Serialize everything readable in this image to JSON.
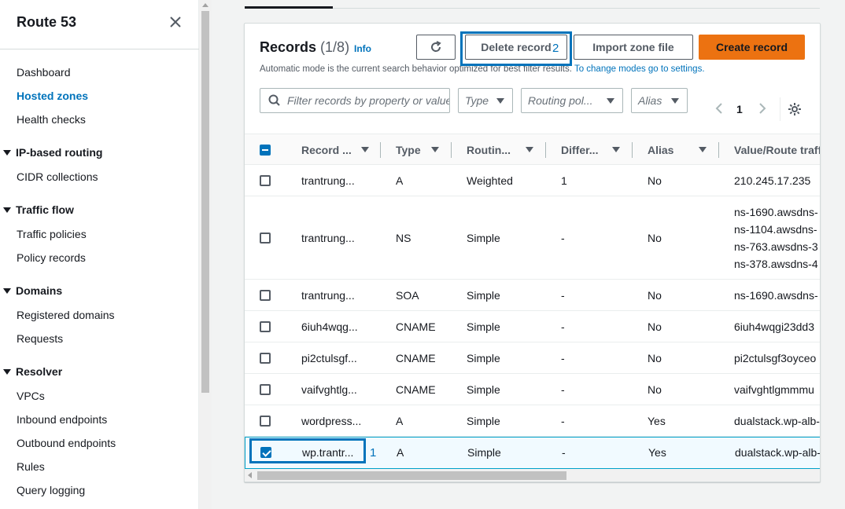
{
  "sidebar": {
    "title": "Route 53",
    "items": [
      {
        "label": "Dashboard"
      },
      {
        "label": "Hosted zones"
      },
      {
        "label": "Health checks"
      }
    ],
    "sections": [
      {
        "label": "IP-based routing",
        "items": [
          "CIDR collections"
        ]
      },
      {
        "label": "Traffic flow",
        "items": [
          "Traffic policies",
          "Policy records"
        ]
      },
      {
        "label": "Domains",
        "items": [
          "Registered domains",
          "Requests"
        ]
      },
      {
        "label": "Resolver",
        "items": [
          "VPCs",
          "Inbound endpoints",
          "Outbound endpoints",
          "Rules",
          "Query logging"
        ]
      }
    ]
  },
  "records": {
    "title": "Records",
    "count": "(1/8)",
    "info": "Info",
    "subtext": "Automatic mode is the current search behavior optimized for best filter results.",
    "subtext_link": "To change modes go to settings.",
    "buttons": {
      "delete": "Delete record",
      "import": "Import zone file",
      "create": "Create record"
    },
    "annotations": {
      "delete": "2",
      "row": "1"
    },
    "filters": {
      "search_placeholder": "Filter records by property or value",
      "type": "Type",
      "routing": "Routing pol...",
      "alias": "Alias"
    },
    "page": "1",
    "columns": [
      "Record ...",
      "Type",
      "Routin...",
      "Differ...",
      "Alias",
      "Value/Route traffic to"
    ],
    "rows": [
      {
        "name": "trantrung...",
        "type": "A",
        "routing": "Weighted",
        "diff": "1",
        "alias": "No",
        "values": [
          "210.245.17.235"
        ],
        "selected": false
      },
      {
        "name": "trantrung...",
        "type": "NS",
        "routing": "Simple",
        "diff": "-",
        "alias": "No",
        "values": [
          "ns-1690.awsdns-",
          "ns-1104.awsdns-",
          "ns-763.awsdns-3",
          "ns-378.awsdns-4"
        ],
        "selected": false
      },
      {
        "name": "trantrung...",
        "type": "SOA",
        "routing": "Simple",
        "diff": "-",
        "alias": "No",
        "values": [
          "ns-1690.awsdns-"
        ],
        "selected": false
      },
      {
        "name": "6iuh4wqg...",
        "type": "CNAME",
        "routing": "Simple",
        "diff": "-",
        "alias": "No",
        "values": [
          "6iuh4wqgi23dd3"
        ],
        "selected": false
      },
      {
        "name": "pi2ctulsgf...",
        "type": "CNAME",
        "routing": "Simple",
        "diff": "-",
        "alias": "No",
        "values": [
          "pi2ctulsgf3oyceo"
        ],
        "selected": false
      },
      {
        "name": "vaifvghtlg...",
        "type": "CNAME",
        "routing": "Simple",
        "diff": "-",
        "alias": "No",
        "values": [
          "vaifvghtlgmmmu"
        ],
        "selected": false
      },
      {
        "name": "wordpress...",
        "type": "A",
        "routing": "Simple",
        "diff": "-",
        "alias": "Yes",
        "values": [
          "dualstack.wp-alb-"
        ],
        "selected": false
      },
      {
        "name": "wp.trantr...",
        "type": "A",
        "routing": "Simple",
        "diff": "-",
        "alias": "Yes",
        "values": [
          "dualstack.wp-alb-"
        ],
        "selected": true
      }
    ]
  },
  "colors": {
    "accent": "#0073bb",
    "primary_button": "#ec7211"
  }
}
